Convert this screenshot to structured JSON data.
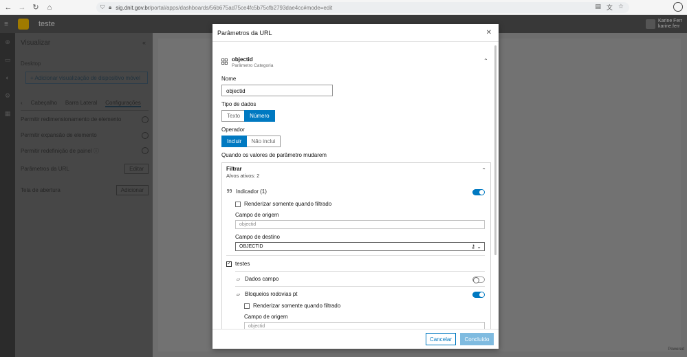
{
  "browser": {
    "url_domain": "sig.dnit.gov.br",
    "url_path": "/portal/apps/dashboards/56b675ad75ce4fc5b75cfb2793dae4cc#mode=edit"
  },
  "app": {
    "title": "teste",
    "user_name": "Karine Ferr",
    "user_sub": "karine.ferr"
  },
  "side_panel": {
    "title": "Visualizar",
    "section_label": "Desktop",
    "add_button": "+ Adicionar visualização de dispositivo móvel",
    "tabs": [
      "Cabeçalho",
      "Barra Lateral",
      "Configurações"
    ],
    "settings": [
      {
        "label": "Permitir redimensionamento de elemento"
      },
      {
        "label": "Permitir expansão de elemento"
      },
      {
        "label": "Permitir redefinição de painel"
      }
    ],
    "url_params_label": "Parâmetros da URL",
    "edit_label": "Editar",
    "opening_screen_label": "Tela de abertura",
    "add_label": "Adicionar"
  },
  "canvas": {
    "powered": "Powered"
  },
  "modal": {
    "title": "Parâmetros da URL",
    "param_name": "objectid",
    "param_type": "Parâmetro Categoria",
    "name_label": "Nome",
    "name_value": "objectid",
    "data_type_label": "Tipo de dados",
    "data_type_options": [
      "Texto",
      "Número"
    ],
    "data_type_selected": "Número",
    "operator_label": "Operador",
    "operator_options": [
      "Incluir",
      "Não inclui"
    ],
    "operator_selected": "Incluir",
    "when_changed_label": "Quando os valores de parâmetro mudarem",
    "filter": {
      "title": "Filtrar",
      "active_targets": "Alvos ativos: 2",
      "indicator_label": "Indicador (1)",
      "indicator_on": true,
      "render_filtered_label": "Renderizar somente quando filtrado",
      "source_field_label": "Campo de origem",
      "source_field_placeholder": "objectid",
      "dest_field_label": "Campo de destino",
      "dest_field_value": "OBJECTID",
      "group_label": "testes",
      "layer1_label": "Dados campo",
      "layer1_on": false,
      "layer2_label": "Bloqueios rodovias pt",
      "layer2_on": true,
      "layer2_render_label": "Renderizar somente quando filtrado",
      "layer2_source_label": "Campo de origem",
      "layer2_source_placeholder": "objectid"
    },
    "cancel_label": "Cancelar",
    "done_label": "Concluído"
  }
}
